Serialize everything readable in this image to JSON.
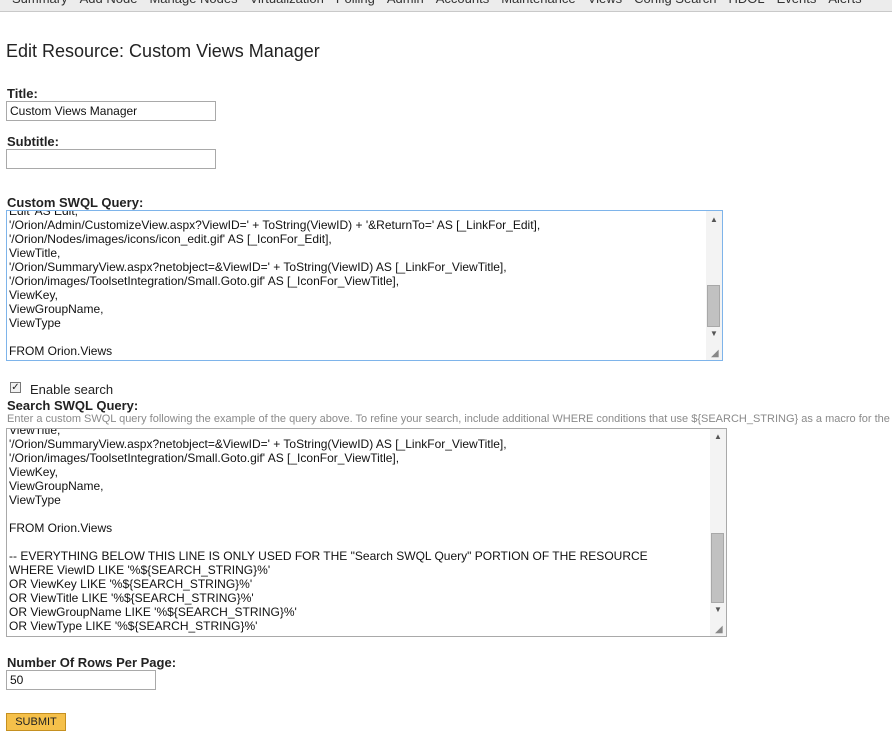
{
  "nav": {
    "items": [
      "Summary",
      "Add Node",
      "Manage Nodes",
      "Virtualization",
      "Polling",
      "Admin",
      "Accounts",
      "Maintenance",
      "Views",
      "Config Search",
      "HDOL",
      "Events",
      "Alerts"
    ]
  },
  "page": {
    "title": "Edit Resource: Custom Views Manager"
  },
  "title_field": {
    "label": "Title:",
    "value": "Custom Views Manager"
  },
  "subtitle_field": {
    "label": "Subtitle:",
    "value": ""
  },
  "custom_query": {
    "label": "Custom SWQL Query:",
    "lines": [
      "Edit' AS Edit,",
      "'/Orion/Admin/CustomizeView.aspx?ViewID=' + ToString(ViewID) + '&ReturnTo=' AS [_LinkFor_Edit],",
      "'/Orion/Nodes/images/icons/icon_edit.gif' AS [_IconFor_Edit],",
      "ViewTitle,",
      "'/Orion/SummaryView.aspx?netobject=&ViewID=' + ToString(ViewID) AS [_LinkFor_ViewTitle],",
      "'/Orion/images/ToolsetIntegration/Small.Goto.gif' AS [_IconFor_ViewTitle],",
      "ViewKey,",
      "ViewGroupName,",
      "ViewType",
      "",
      "FROM Orion.Views"
    ]
  },
  "enable_search": {
    "label": "Enable search",
    "checked": true
  },
  "search_query": {
    "label": "Search SWQL Query:",
    "help": "Enter a custom SWQL query following the example of the query above. To refine your search, include additional WHERE conditions that use ${SEARCH_STRING} as a macro for the string",
    "lines": [
      "ViewTitle,",
      "'/Orion/SummaryView.aspx?netobject=&ViewID=' + ToString(ViewID) AS [_LinkFor_ViewTitle],",
      "'/Orion/images/ToolsetIntegration/Small.Goto.gif' AS [_IconFor_ViewTitle],",
      "ViewKey,",
      "ViewGroupName,",
      "ViewType",
      "",
      "FROM Orion.Views",
      "",
      "-- EVERYTHING BELOW THIS LINE IS ONLY USED FOR THE \"Search SWQL Query\" PORTION OF THE RESOURCE",
      "WHERE ViewID LIKE '%${SEARCH_STRING}%'",
      "OR ViewKey LIKE '%${SEARCH_STRING}%'",
      "OR ViewTitle LIKE '%${SEARCH_STRING}%'",
      "OR ViewGroupName LIKE '%${SEARCH_STRING}%'",
      "OR ViewType LIKE '%${SEARCH_STRING}%'"
    ]
  },
  "rows_per_page": {
    "label": "Number Of Rows Per Page:",
    "value": "50"
  },
  "submit": {
    "label": "SUBMIT"
  },
  "colors": {
    "submit_bg": "#f5c04a",
    "nav_bg": "#ececec"
  },
  "icons": {
    "resize_grip": "resize-grip-icon",
    "scroll_up": "scroll-up-icon",
    "scroll_down": "scroll-down-icon",
    "check": "check-icon"
  }
}
